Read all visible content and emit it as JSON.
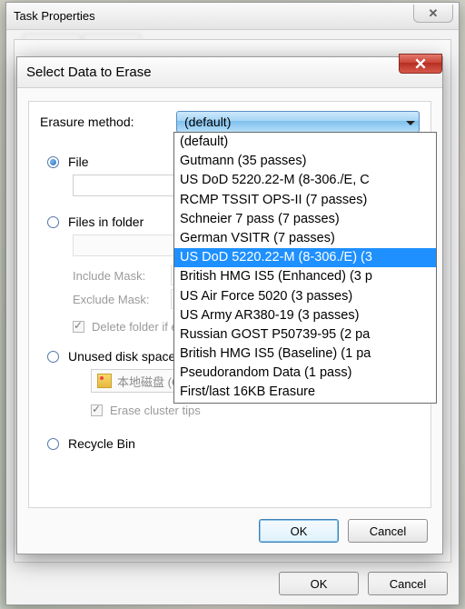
{
  "outer": {
    "title": "Task Properties",
    "ok": "OK",
    "cancel": "Cancel"
  },
  "inner": {
    "title": "Select Data to Erase",
    "ok": "OK",
    "cancel": "Cancel"
  },
  "method": {
    "label": "Erasure method:",
    "selected": "(default)"
  },
  "targets": {
    "file": "File",
    "folder": "Files in folder",
    "include": "Include Mask:",
    "exclude": "Exclude Mask:",
    "delete_folder": "Delete folder if empty",
    "unused": "Unused disk space",
    "drive": "本地磁盘 (C:)",
    "cluster": "Erase cluster tips",
    "recycle": "Recycle Bin"
  },
  "options": [
    "(default)",
    "Gutmann (35 passes)",
    "US DoD 5220.22-M (8-306./E, C",
    "RCMP TSSIT OPS-II (7 passes)",
    "Schneier 7 pass (7 passes)",
    "German VSITR (7 passes)",
    "US DoD 5220.22-M (8-306./E) (3",
    "British HMG IS5 (Enhanced) (3 p",
    "US Air Force 5020 (3 passes)",
    "US Army AR380-19 (3 passes)",
    "Russian GOST P50739-95 (2 pa",
    "British HMG IS5 (Baseline) (1 pa",
    "Pseudorandom Data (1 pass)",
    "First/last 16KB Erasure"
  ],
  "selected_option_index": 6
}
